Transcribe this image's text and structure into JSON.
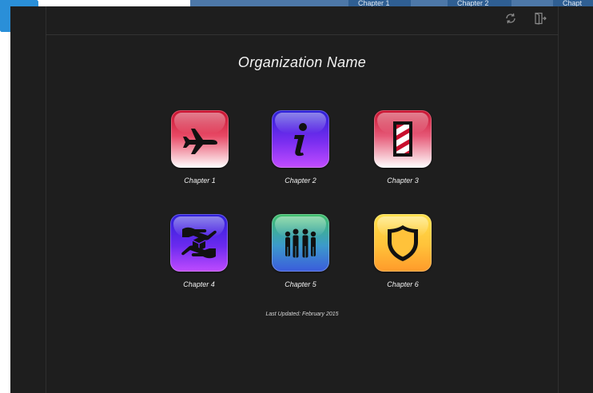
{
  "background_tabs": [
    "Chapter 1",
    "Chapter 2",
    "Chapt"
  ],
  "toolbar": {
    "refresh_icon": "refresh-icon",
    "exit_icon": "exit-icon"
  },
  "organization": {
    "name": "Organization Name"
  },
  "chapters": [
    {
      "label": "Chapter 1",
      "icon": "airplane-icon",
      "color": "#c8102e"
    },
    {
      "label": "Chapter 2",
      "icon": "info-icon",
      "color": "#5a24e6"
    },
    {
      "label": "Chapter 3",
      "icon": "barber-pole-icon",
      "color": "#c8102e"
    },
    {
      "label": "Chapter 4",
      "icon": "hands-cube-icon",
      "color": "#5a24e6"
    },
    {
      "label": "Chapter 5",
      "icon": "people-group-icon",
      "color": "#3c9acb"
    },
    {
      "label": "Chapter 6",
      "icon": "shield-icon",
      "color": "#ffc23a"
    }
  ],
  "footer": {
    "last_updated": "Last Updated: February 2015"
  }
}
